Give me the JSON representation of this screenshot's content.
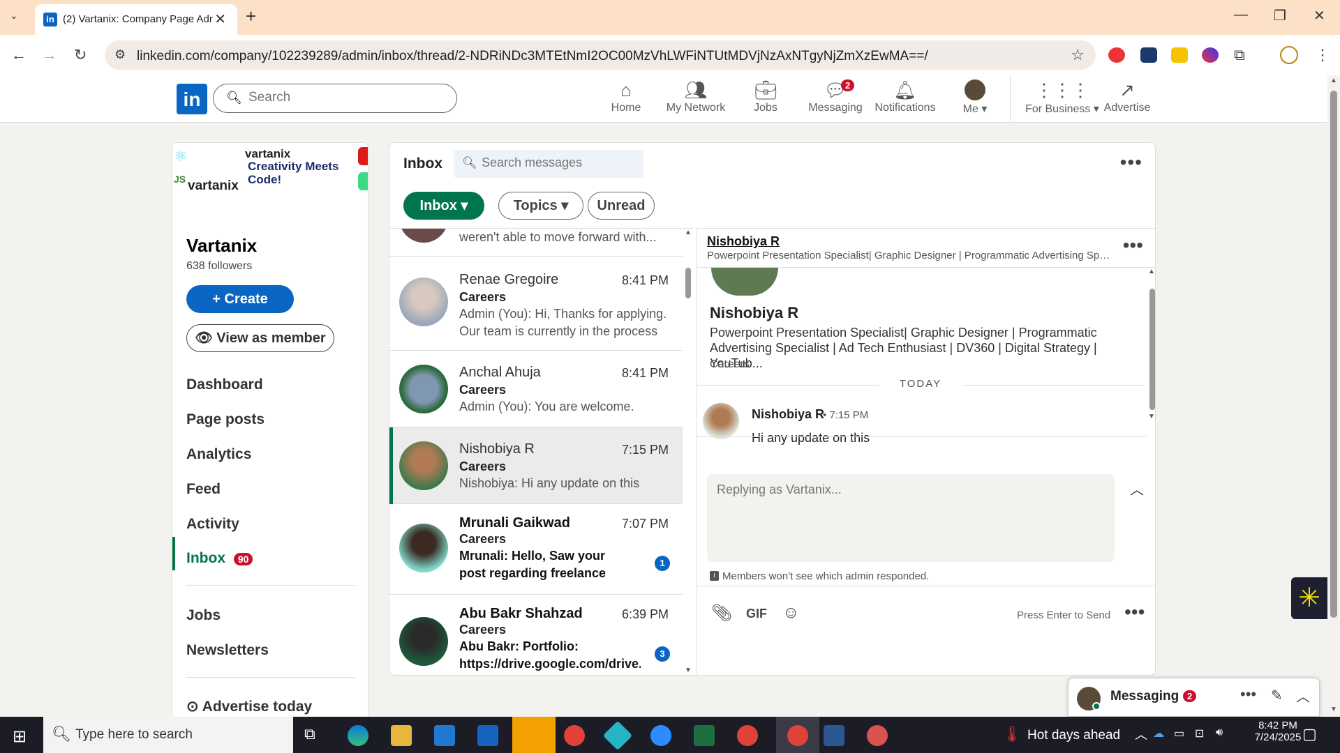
{
  "browser": {
    "tab_title": "(2) Vartanix: Company Page Admin",
    "tab_icon": "linkedin-icon",
    "url": "linkedin.com/company/102239289/admin/inbox/thread/2-NDRiNDc3MTEtNmI2OC00MzVhLWFiNTUtMDVjNzAxNTgyNjZmXzEwMA==/"
  },
  "linkedin_header": {
    "logo": "in",
    "search_placeholder": "Search",
    "nav": [
      {
        "label": "Home",
        "icon": "home-icon"
      },
      {
        "label": "My Network",
        "icon": "network-icon"
      },
      {
        "label": "Jobs",
        "icon": "briefcase-icon"
      },
      {
        "label": "Messaging",
        "icon": "messaging-icon",
        "badge": "2"
      },
      {
        "label": "Notifications",
        "icon": "bell-icon"
      },
      {
        "label": "Me",
        "icon": "avatar"
      },
      {
        "label": "For Business",
        "icon": "grid-icon"
      },
      {
        "label": "Advertise",
        "icon": "advertise-icon"
      }
    ]
  },
  "left_panel": {
    "banner": {
      "brand_1": "vartanix",
      "tagline": "Creativity Meets Code!",
      "brand_2": "vartanix"
    },
    "org_name": "Vartanix",
    "followers": "638 followers",
    "create_label": "Create",
    "view_as_member_label": "View as member",
    "nav": [
      {
        "label": "Dashboard"
      },
      {
        "label": "Page posts"
      },
      {
        "label": "Analytics"
      },
      {
        "label": "Feed"
      },
      {
        "label": "Activity"
      },
      {
        "label": "Inbox",
        "badge": "90",
        "active": true
      },
      {
        "label": "Jobs"
      },
      {
        "label": "Newsletters"
      },
      {
        "label": "Advertise today"
      }
    ]
  },
  "inbox": {
    "title": "Inbox",
    "search_placeholder": "Search messages",
    "filters": [
      {
        "label": "Inbox"
      },
      {
        "label": "Topics"
      },
      {
        "label": "Unread"
      }
    ],
    "conversations": [
      {
        "name": "",
        "time": "",
        "topic": "",
        "preview": "weren't able to move forward with...",
        "partial": true
      },
      {
        "name": "Renae Gregoire",
        "time": "8:41 PM",
        "topic": "Careers",
        "preview": "Admin (You): Hi, Thanks for applying. Our team is currently in the process ..."
      },
      {
        "name": "Anchal Ahuja",
        "time": "8:41 PM",
        "topic": "Careers",
        "preview": "Admin (You): You are welcome."
      },
      {
        "name": "Nishobiya R",
        "time": "7:15 PM",
        "topic": "Careers",
        "preview": "Nishobiya: Hi any update on this",
        "selected": true
      },
      {
        "name": "Mrunali Gaikwad",
        "time": "7:07 PM",
        "topic": "Careers",
        "preview": "Mrunali: Hello, Saw your post regarding freelance content...",
        "unread": "1"
      },
      {
        "name": "Abu Bakr Shahzad",
        "time": "6:39 PM",
        "topic": "Careers",
        "preview": "Abu Bakr: Portfolio: https://drive.google.com/drive...",
        "unread": "3"
      }
    ],
    "thread": {
      "name": "Nishobiya R",
      "headline_short": "Powerpoint Presentation Specialist| Graphic Designer | Programmatic Advertising Spe...",
      "profile_name": "Nishobiya R",
      "profile_headline": "Powerpoint Presentation Specialist| Graphic Designer | Programmatic Advertising Specialist | Ad Tech Enthusiast | DV360 | Digital Strategy | YouTub...",
      "topic": "Careers",
      "day_divider": "TODAY",
      "messages": [
        {
          "sender": "Nishobiya R",
          "time": "• 7:15 PM",
          "body": "Hi any update on this"
        }
      ],
      "reply_placeholder": "Replying as Vartanix...",
      "admin_note": "Members won't see which admin responded.",
      "press_enter": "Press Enter to Send",
      "gif_label": "GIF"
    }
  },
  "messaging_widget": {
    "label": "Messaging",
    "badge": "2"
  },
  "taskbar": {
    "search_placeholder": "Type here to search",
    "weather": "Hot days ahead",
    "time": "8:42 PM",
    "date": "7/24/2025"
  },
  "colors": {
    "linkedin_blue": "#0a66c2",
    "inbox_green": "#01754f",
    "tab_bar": "#fce1c7",
    "badge_red": "#cb112d"
  }
}
